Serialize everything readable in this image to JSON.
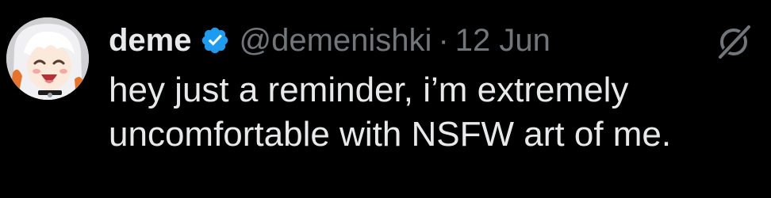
{
  "post": {
    "author_name": "deme",
    "verified_icon": "verified-badge-icon",
    "handle": "@demenishki",
    "separator": "·",
    "date": "12 Jun",
    "text_lines": [
      "hey just a reminder, i’m extremely",
      "uncomfortable with NSFW art of me."
    ]
  },
  "icons": {
    "avatar": "avatar-anime-girl",
    "grok": "grok-icon"
  },
  "colors": {
    "background": "#000000",
    "primary_text": "#e7e9ea",
    "secondary_text": "#71767b",
    "verified_blue": "#1d9bf0"
  }
}
